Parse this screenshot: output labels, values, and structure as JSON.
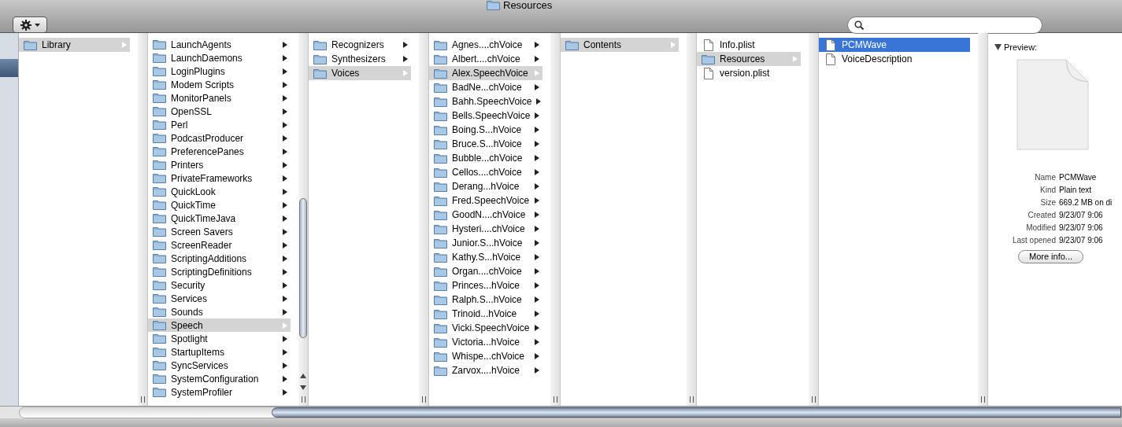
{
  "window": {
    "title": "Resources"
  },
  "columns": [
    {
      "active": false,
      "items": [
        {
          "name": "Library",
          "kind": "folder",
          "selected": true
        }
      ]
    },
    {
      "active": false,
      "scrollbar": true,
      "items": [
        {
          "name": "LaunchAgents",
          "kind": "folder",
          "selected": false
        },
        {
          "name": "LaunchDaemons",
          "kind": "folder",
          "selected": false
        },
        {
          "name": "LoginPlugins",
          "kind": "folder",
          "selected": false
        },
        {
          "name": "Modem Scripts",
          "kind": "folder",
          "selected": false
        },
        {
          "name": "MonitorPanels",
          "kind": "folder",
          "selected": false
        },
        {
          "name": "OpenSSL",
          "kind": "folder",
          "selected": false
        },
        {
          "name": "Perl",
          "kind": "folder",
          "selected": false
        },
        {
          "name": "PodcastProducer",
          "kind": "folder",
          "selected": false
        },
        {
          "name": "PreferencePanes",
          "kind": "folder",
          "selected": false
        },
        {
          "name": "Printers",
          "kind": "folder",
          "selected": false
        },
        {
          "name": "PrivateFrameworks",
          "kind": "folder",
          "selected": false
        },
        {
          "name": "QuickLook",
          "kind": "folder",
          "selected": false
        },
        {
          "name": "QuickTime",
          "kind": "folder",
          "selected": false
        },
        {
          "name": "QuickTimeJava",
          "kind": "folder",
          "selected": false
        },
        {
          "name": "Screen Savers",
          "kind": "folder",
          "selected": false
        },
        {
          "name": "ScreenReader",
          "kind": "folder",
          "selected": false
        },
        {
          "name": "ScriptingAdditions",
          "kind": "folder",
          "selected": false
        },
        {
          "name": "ScriptingDefinitions",
          "kind": "folder",
          "selected": false
        },
        {
          "name": "Security",
          "kind": "folder",
          "selected": false
        },
        {
          "name": "Services",
          "kind": "folder",
          "selected": false
        },
        {
          "name": "Sounds",
          "kind": "folder",
          "selected": false
        },
        {
          "name": "Speech",
          "kind": "folder",
          "selected": true
        },
        {
          "name": "Spotlight",
          "kind": "folder",
          "selected": false
        },
        {
          "name": "StartupItems",
          "kind": "folder",
          "selected": false
        },
        {
          "name": "SyncServices",
          "kind": "folder",
          "selected": false
        },
        {
          "name": "SystemConfiguration",
          "kind": "folder",
          "selected": false
        },
        {
          "name": "SystemProfiler",
          "kind": "folder",
          "selected": false
        }
      ]
    },
    {
      "active": false,
      "items": [
        {
          "name": "Recognizers",
          "kind": "folder",
          "selected": false
        },
        {
          "name": "Synthesizers",
          "kind": "folder",
          "selected": false
        },
        {
          "name": "Voices",
          "kind": "folder",
          "selected": true
        }
      ]
    },
    {
      "active": false,
      "items": [
        {
          "name": "Agnes....chVoice",
          "kind": "folder",
          "selected": false
        },
        {
          "name": "Albert....chVoice",
          "kind": "folder",
          "selected": false
        },
        {
          "name": "Alex.SpeechVoice",
          "kind": "folder",
          "selected": true
        },
        {
          "name": "BadNe...chVoice",
          "kind": "folder",
          "selected": false
        },
        {
          "name": "Bahh.SpeechVoice",
          "kind": "folder",
          "selected": false
        },
        {
          "name": "Bells.SpeechVoice",
          "kind": "folder",
          "selected": false
        },
        {
          "name": "Boing.S...hVoice",
          "kind": "folder",
          "selected": false
        },
        {
          "name": "Bruce.S...hVoice",
          "kind": "folder",
          "selected": false
        },
        {
          "name": "Bubble...chVoice",
          "kind": "folder",
          "selected": false
        },
        {
          "name": "Cellos....chVoice",
          "kind": "folder",
          "selected": false
        },
        {
          "name": "Derang...hVoice",
          "kind": "folder",
          "selected": false
        },
        {
          "name": "Fred.SpeechVoice",
          "kind": "folder",
          "selected": false
        },
        {
          "name": "GoodN....chVoice",
          "kind": "folder",
          "selected": false
        },
        {
          "name": "Hysteri....chVoice",
          "kind": "folder",
          "selected": false
        },
        {
          "name": "Junior.S...hVoice",
          "kind": "folder",
          "selected": false
        },
        {
          "name": "Kathy.S...hVoice",
          "kind": "folder",
          "selected": false
        },
        {
          "name": "Organ....chVoice",
          "kind": "folder",
          "selected": false
        },
        {
          "name": "Princes...hVoice",
          "kind": "folder",
          "selected": false
        },
        {
          "name": "Ralph.S...hVoice",
          "kind": "folder",
          "selected": false
        },
        {
          "name": "Trinoid...hVoice",
          "kind": "folder",
          "selected": false
        },
        {
          "name": "Vicki.SpeechVoice",
          "kind": "folder",
          "selected": false
        },
        {
          "name": "Victoria...hVoice",
          "kind": "folder",
          "selected": false
        },
        {
          "name": "Whispe...chVoice",
          "kind": "folder",
          "selected": false
        },
        {
          "name": "Zarvox....hVoice",
          "kind": "folder",
          "selected": false
        }
      ]
    },
    {
      "active": false,
      "items": [
        {
          "name": "Contents",
          "kind": "folder",
          "selected": true
        }
      ]
    },
    {
      "active": false,
      "items": [
        {
          "name": "Info.plist",
          "kind": "file",
          "selected": false
        },
        {
          "name": "Resources",
          "kind": "folder",
          "selected": true
        },
        {
          "name": "version.plist",
          "kind": "file",
          "selected": false
        }
      ]
    },
    {
      "active": true,
      "items": [
        {
          "name": "PCMWave",
          "kind": "file",
          "selected": true
        },
        {
          "name": "VoiceDescription",
          "kind": "file",
          "selected": false
        }
      ]
    }
  ],
  "preview": {
    "heading": "Preview:",
    "expanded": true,
    "info": [
      {
        "label": "Name",
        "value": "PCMWave"
      },
      {
        "label": "Kind",
        "value": "Plain text"
      },
      {
        "label": "Size",
        "value": "669.2 MB on di"
      },
      {
        "label": "Created",
        "value": "9/23/07 9:06"
      },
      {
        "label": "Modified",
        "value": "9/23/07 9:06"
      },
      {
        "label": "Last opened",
        "value": "9/23/07 9:06"
      }
    ],
    "button": "More info..."
  }
}
